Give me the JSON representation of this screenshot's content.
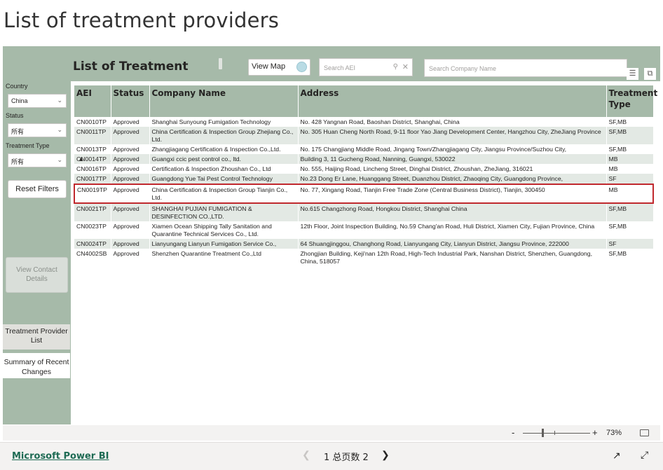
{
  "page": {
    "title": "List of treatment providers"
  },
  "filters": {
    "country_label": "Country",
    "country_value": "China",
    "status_label": "Status",
    "status_value": "所有",
    "treatment_type_label": "Treatment Type",
    "treatment_type_value": "所有",
    "reset_label": "Reset Filters"
  },
  "sidebar": {
    "contact_label": "View Contact Details",
    "nav_items": [
      "Treatment Provider List",
      "Summary of Recent Changes"
    ]
  },
  "visual": {
    "title": "List of Treatment",
    "view_map_label": "View Map",
    "search_aei_placeholder": "Search AEI",
    "search_company_placeholder": "Search Company Name"
  },
  "table": {
    "columns": [
      "AEI",
      "Status",
      "Company Name",
      "Address",
      "Treatment Type"
    ],
    "rows": [
      {
        "aei": "CN0010TP",
        "status": "Approved",
        "company": "Shanghai Sunyoung Fumigation Technology",
        "address": "No. 428 Yangnan Road, Baoshan District, Shanghai, China",
        "type": "SF,MB"
      },
      {
        "aei": "CN0011TP",
        "status": "Approved",
        "company": "China Certification & Inspection Group Zhejiang Co., Ltd.",
        "address": "No. 305 Huan Cheng North Road, 9-11 floor Yao Jiang Development Center, Hangzhou City, ZheJiang Province",
        "type": "SF,MB"
      },
      {
        "aei": "CN0013TP",
        "status": "Approved",
        "company": "Zhangjiagang Certification & Inspection Co.,Ltd.",
        "address": "No. 175 Changjiang Middle Road, Jingang Town/Zhangjiagang City, Jiangsu Province/Suzhou City,",
        "type": "SF,MB"
      },
      {
        "aei": "CN0014TP",
        "status": "Approved",
        "company": "Guangxi ccic pest control co., ltd.",
        "address": "Building 3, 11 Gucheng Road, Nanning, Guangxi, 530022",
        "type": "MB"
      },
      {
        "aei": "CN0016TP",
        "status": "Approved",
        "company": "Certification & Inspection Zhoushan Co., Ltd",
        "address": "No. 555, Haijing Road, Lincheng Street, Dinghai District, Zhoushan, ZheJiang, 316021",
        "type": "MB"
      },
      {
        "aei": "CN0017TP",
        "status": "Approved",
        "company": "Guangdong Yue Tai Pest Control Technology",
        "address": "No.23 Dong Er Lane, Huanggang Street, Duanzhou District, Zhaoqing City, Guangdong Province,",
        "type": "SF"
      },
      {
        "aei": "CN0019TP",
        "status": "Approved",
        "company": "China Certification & Inspection Group Tianjin Co., Ltd.",
        "address": "No. 77, Xingang Road, Tianjin Free Trade Zone (Central Business District), Tianjin, 300450",
        "type": "MB"
      },
      {
        "aei": "CN0021TP",
        "status": "Approved",
        "company": "SHANGHAI PUJIAN FUMIGATION & DESINFECTION CO.,LTD.",
        "address": "No.615 Changzhong Road, Hongkou District, Shanghai China",
        "type": "SF,MB"
      },
      {
        "aei": "CN0023TP",
        "status": "Approved",
        "company": "Xiamen Ocean Shipping Tally Sanitation and Quarantine Technical Services Co., Ltd.",
        "address": "12th Floor, Joint Inspection Building, No.59 Chang'an Road, Huli District, Xiamen City, Fujian Province, China",
        "type": "SF,MB"
      },
      {
        "aei": "CN0024TP",
        "status": "Approved",
        "company": "Lianyungang Lianyun Fumigation Service Co.,",
        "address": "64 Shuangjinggou, Changhong Road, Lianyungang City, Lianyun District, Jiangsu Province, 222000",
        "type": "SF"
      },
      {
        "aei": "CN4002SB",
        "status": "Approved",
        "company": "Shenzhen Quarantine Treatment Co.,Ltd",
        "address": "Zhongjian Building, Keji'nan 12th Road, High-Tech Industrial Park, Nanshan District, Shenzhen, Guangdong, China, 518057",
        "type": "SF,MB"
      }
    ]
  },
  "zoom": {
    "minus": "-",
    "plus": "+",
    "value": "73%",
    "level": 0.73
  },
  "footer": {
    "brand": "Microsoft Power BI",
    "pager": "1 总页数 2",
    "prev_icon": "chevron-left",
    "next_icon": "chevron-right"
  },
  "colors": {
    "accent": "#a6baa9",
    "alt_row": "#e3e9e4",
    "highlight": "#c0282d",
    "brand_link": "#1e6b54"
  }
}
